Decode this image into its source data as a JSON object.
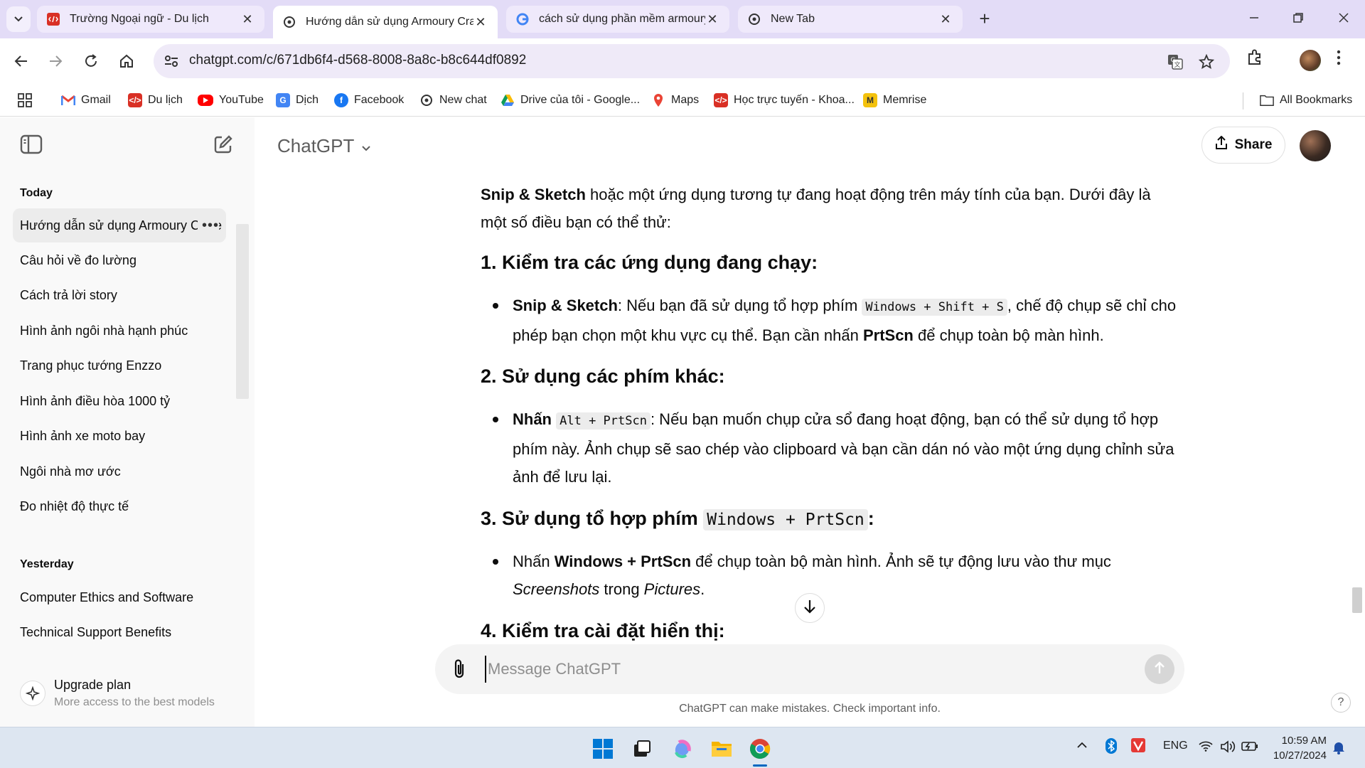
{
  "browser": {
    "tabs": [
      {
        "title": "Trường Ngoại ngữ - Du lịch",
        "favicon": "site-red-icon",
        "active": false
      },
      {
        "title": "Hướng dẫn sử dụng Armoury Crat",
        "favicon": "openai-icon",
        "active": true
      },
      {
        "title": "cách sử dụng phần mềm armoury",
        "favicon": "google-icon",
        "active": false
      },
      {
        "title": "New Tab",
        "favicon": "openai-icon",
        "active": false
      }
    ],
    "new_tab_symbol": "+",
    "close_symbol": "✕",
    "address": "chatgpt.com/c/671db6f4-d568-8008-8a8c-b8c644df0892"
  },
  "bookmarks": {
    "items": [
      {
        "label": "Gmail",
        "icon": "gmail-icon",
        "color": "#ea4335"
      },
      {
        "label": "Du lịch",
        "icon": "site-red-icon",
        "color": "#d93025"
      },
      {
        "label": "YouTube",
        "icon": "youtube-icon",
        "color": "#ff0000"
      },
      {
        "label": "Dịch",
        "icon": "translate-icon",
        "color": "#4285f4"
      },
      {
        "label": "Facebook",
        "icon": "facebook-icon",
        "color": "#1877f2"
      },
      {
        "label": "New chat",
        "icon": "openai-icon",
        "color": "#333333"
      },
      {
        "label": "Drive của tôi - Google...",
        "icon": "drive-icon",
        "color": "#0f9d58"
      },
      {
        "label": "Maps",
        "icon": "maps-icon",
        "color": "#34a853"
      },
      {
        "label": "Học trực tuyến - Khoa...",
        "icon": "site-red-icon",
        "color": "#d93025"
      },
      {
        "label": "Memrise",
        "icon": "memrise-icon",
        "color": "#f4c20d"
      }
    ],
    "all_bookmarks": "All Bookmarks"
  },
  "sidebar": {
    "sections": [
      {
        "heading": "Today",
        "items": [
          "Hướng dẫn sử dụng Armoury Crate",
          "Câu hỏi về đo lường",
          "Cách trả lời story",
          "Hình ảnh ngôi nhà hạnh phúc",
          "Trang phục tướng Enzzo",
          "Hình ảnh điều hòa 1000 tỷ",
          "Hình ảnh xe moto bay",
          "Ngôi nhà mơ ước",
          "Đo nhiệt độ thực tế"
        ]
      },
      {
        "heading": "Yesterday",
        "items": [
          "Computer Ethics and Software",
          "Technical Support Benefits"
        ]
      }
    ],
    "more_symbol": "•••",
    "upgrade_title": "Upgrade plan",
    "upgrade_subtitle": "More access to the best models"
  },
  "header": {
    "model": "ChatGPT",
    "share": "Share"
  },
  "conversation": {
    "intro": {
      "bold": "Snip & Sketch",
      "rest": " hoặc một ứng dụng tương tự đang hoạt động trên máy tính của bạn. Dưới đây là một số điều bạn có thể thử:"
    },
    "s1": {
      "heading": "1. Kiểm tra các ứng dụng đang chạy:",
      "bold1": "Snip & Sketch",
      "t1": ": Nếu bạn đã sử dụng tổ hợp phím ",
      "code": "Windows + Shift + S",
      "t2": ", chế độ chụp sẽ chỉ cho phép bạn chọn một khu vực cụ thể. Bạn cần nhấn ",
      "bold2": "PrtScn",
      "t3": " để chụp toàn bộ màn hình."
    },
    "s2": {
      "heading": "2. Sử dụng các phím khác:",
      "bold1": "Nhấn",
      "t1": " ",
      "code": "Alt + PrtScn",
      "t2": ": Nếu bạn muốn chụp cửa sổ đang hoạt động, bạn có thể sử dụng tổ hợp phím này. Ảnh chụp sẽ sao chép vào clipboard và bạn cần dán nó vào một ứng dụng chỉnh sửa ảnh để lưu lại."
    },
    "s3": {
      "heading_pre": "3. Sử dụng tổ hợp phím ",
      "heading_code": "Windows + PrtScn",
      "heading_post": ":",
      "t1": "Nhấn ",
      "bold1": "Windows + PrtScn",
      "t2": " để chụp toàn bộ màn hình. Ảnh sẽ tự động lưu vào thư mục ",
      "em1": "Screenshots",
      "t3": " trong ",
      "em2": "Pictures",
      "t4": "."
    },
    "s4": {
      "heading": "4. Kiểm tra cài đặt hiển thị:"
    }
  },
  "composer": {
    "placeholder": "Message ChatGPT",
    "value": "",
    "disclaimer": "ChatGPT can make mistakes. Check important info.",
    "help": "?"
  },
  "taskbar": {
    "apps": [
      "windows-start-icon",
      "task-view-icon",
      "copilot-icon",
      "file-explorer-icon",
      "chrome-icon"
    ],
    "language": "ENG",
    "time": "10:59 AM",
    "date": "10/27/2024"
  },
  "colors": {
    "tabstrip_bg": "#e3dcf7",
    "omnibox_bg": "#efeaf8",
    "sidebar_bg": "#f9f9f9",
    "taskbar_bg": "#dde6f1"
  }
}
